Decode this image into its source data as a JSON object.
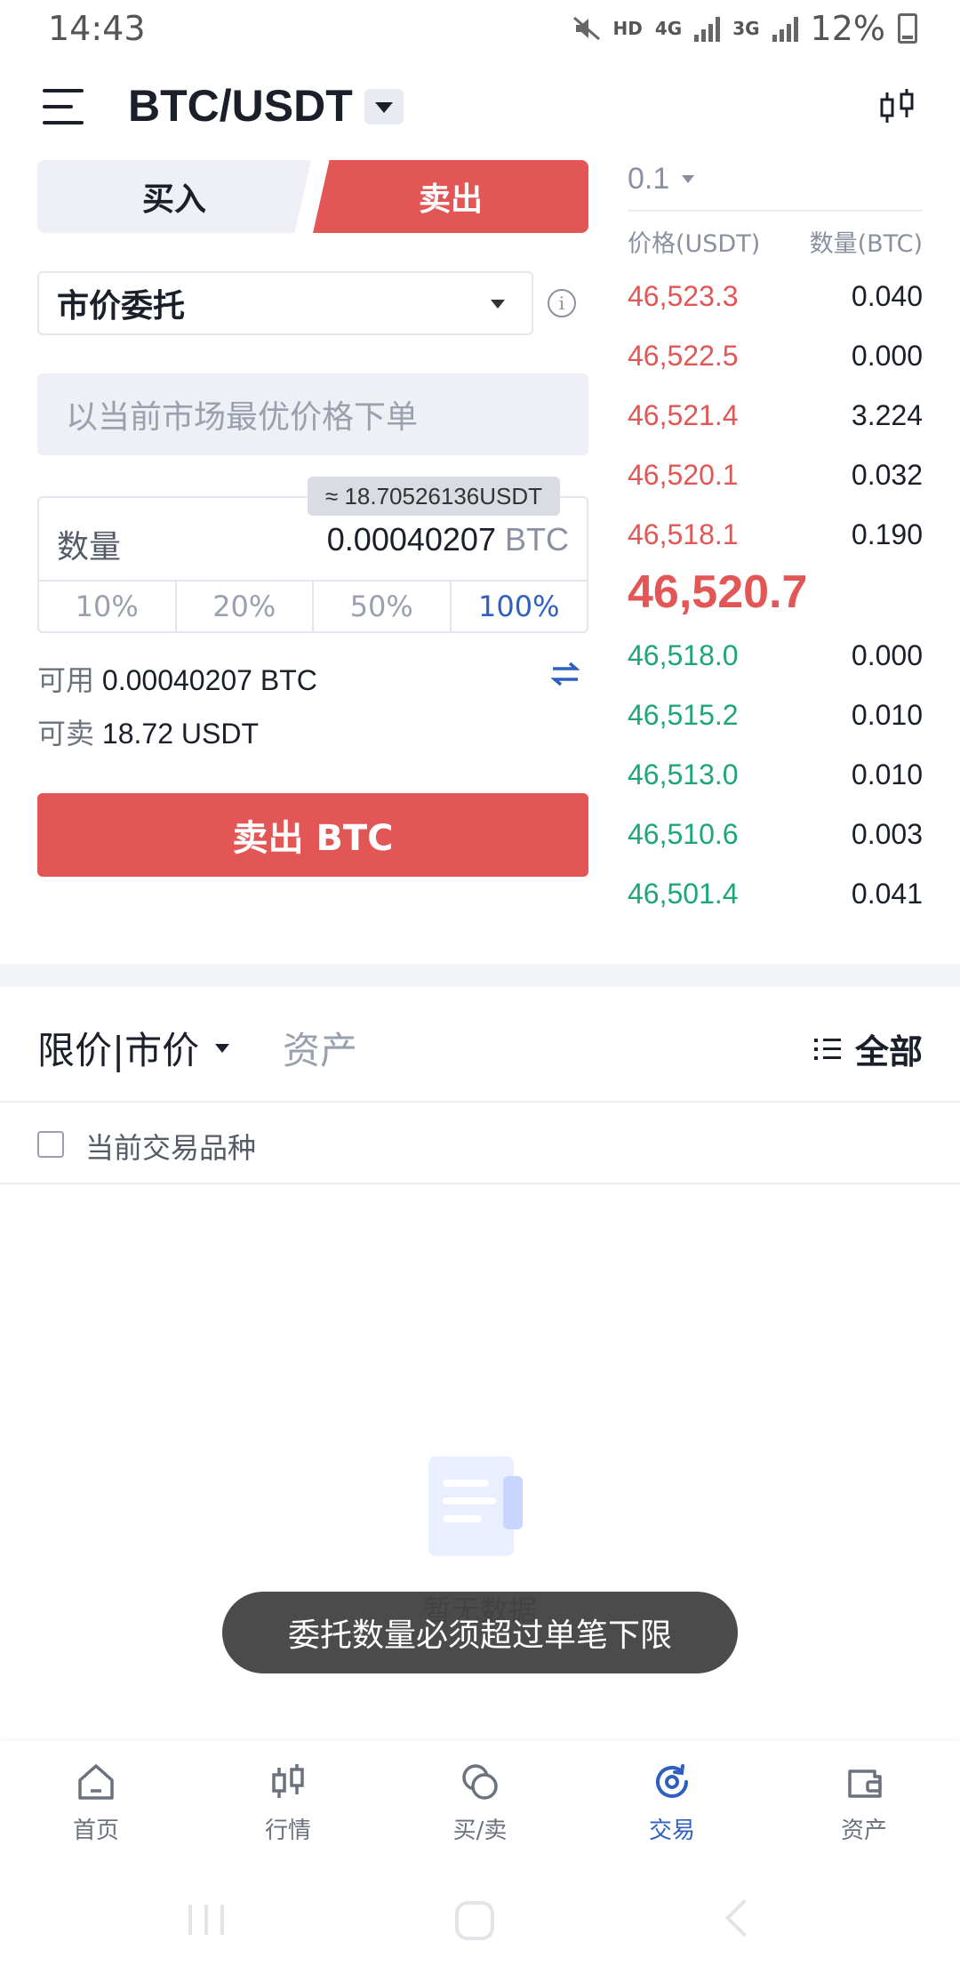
{
  "status_bar": {
    "time": "14:43",
    "hd_label": "HD",
    "net_4g": "4G",
    "net_3g": "3G",
    "battery": "12%"
  },
  "header": {
    "pair": "BTC/USDT"
  },
  "trade": {
    "buy_tab": "买入",
    "sell_tab": "卖出",
    "order_type": "市价委托",
    "price_placeholder": "以当前市场最优价格下单",
    "amount_label": "数量",
    "amount_value": "0.00040207",
    "amount_unit": "BTC",
    "estimate_tooltip": "≈ 18.70526136USDT",
    "percentages": [
      "10%",
      "20%",
      "50%",
      "100%"
    ],
    "available_label": "可用",
    "available_value": "0.00040207 BTC",
    "sellable_label": "可卖",
    "sellable_value": "18.72 USDT",
    "submit_label": "卖出 BTC"
  },
  "order_book": {
    "precision": "0.1",
    "price_header": "价格(USDT)",
    "qty_header": "数量(BTC)",
    "asks": [
      {
        "price": "46,523.3",
        "qty": "0.040"
      },
      {
        "price": "46,522.5",
        "qty": "0.000"
      },
      {
        "price": "46,521.4",
        "qty": "3.224"
      },
      {
        "price": "46,520.1",
        "qty": "0.032"
      },
      {
        "price": "46,518.1",
        "qty": "0.190"
      }
    ],
    "last_price": "46,520.7",
    "bids": [
      {
        "price": "46,518.0",
        "qty": "0.000"
      },
      {
        "price": "46,515.2",
        "qty": "0.010"
      },
      {
        "price": "46,513.0",
        "qty": "0.010"
      },
      {
        "price": "46,510.6",
        "qty": "0.003"
      },
      {
        "price": "46,501.4",
        "qty": "0.041"
      }
    ]
  },
  "orders": {
    "tab_limit_market": "限价|市价",
    "tab_assets": "资产",
    "filter_all": "全部",
    "current_pair_filter": "当前交易品种",
    "empty_text": "暂无数据"
  },
  "toast": "委托数量必须超过单笔下限",
  "bottom_nav": {
    "items": [
      "首页",
      "行情",
      "买/卖",
      "交易",
      "资产"
    ]
  },
  "colors": {
    "sell_red": "#e35656",
    "buy_green": "#1fa57a",
    "accent_blue": "#2f5fbf"
  }
}
